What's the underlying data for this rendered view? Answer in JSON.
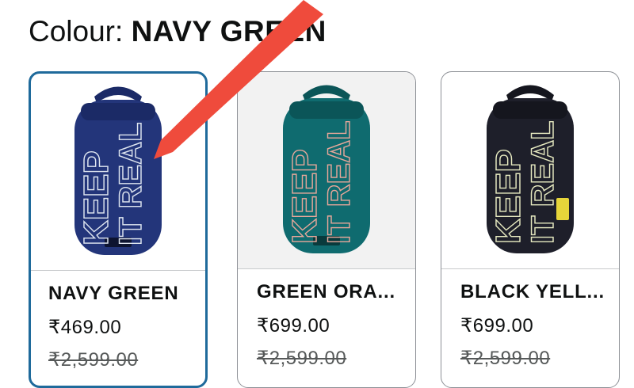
{
  "colour": {
    "label": "Colour: ",
    "value": "NAVY GREEN"
  },
  "variants": [
    {
      "name": "NAVY GREEN",
      "price": "₹469.00",
      "mrp": "₹2,599.00",
      "selected": true,
      "bag_color": "#23357a",
      "strap_color": "#1b2a66",
      "text_color": "#dfe6f0",
      "bag_text": [
        "KEEP",
        "IT REAL"
      ]
    },
    {
      "name": "GREEN ORA...",
      "price": "₹699.00",
      "mrp": "₹2,599.00",
      "selected": false,
      "bag_color": "#0f6b6f",
      "strap_color": "#0b5558",
      "text_color": "#e8a79a",
      "bag_text": [
        "KEEP",
        "IT REAL"
      ]
    },
    {
      "name": "BLACK YELL...",
      "price": "₹699.00",
      "mrp": "₹2,599.00",
      "selected": false,
      "bag_color": "#1e1f2a",
      "strap_color": "#15161e",
      "text_color": "#e6e9c0",
      "bag_text": [
        "KEEP",
        "IT REAL"
      ]
    }
  ],
  "annotation": {
    "arrow_color": "#ef4b3c",
    "icon": "pointer-arrow-annotation"
  },
  "colors": {
    "selected_border": "#1f6a9b",
    "border": "#8d9096"
  }
}
